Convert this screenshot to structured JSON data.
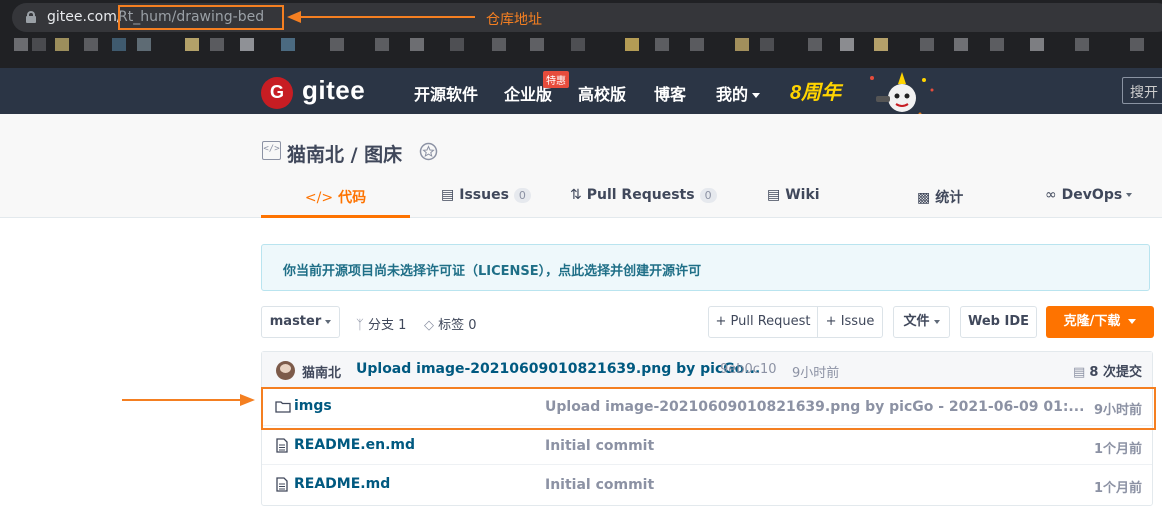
{
  "browser": {
    "url_host": "gitee.com/",
    "url_path": "Rt_hum/drawing-bed"
  },
  "annotation": {
    "url_label": "仓库地址",
    "color": "#f47f21"
  },
  "header": {
    "logo_text": "gitee",
    "nav": [
      "开源软件",
      "企业版",
      "高校版",
      "博客",
      "我的"
    ],
    "enterprise_badge": "特惠",
    "anniversary": "8周年",
    "search_placeholder": "搜开"
  },
  "repo": {
    "title": "猫南北 / 图床",
    "tabs": [
      {
        "label": "代码",
        "icon": "code-icon"
      },
      {
        "label": "Issues",
        "count": "0",
        "icon": "issues-icon"
      },
      {
        "label": "Pull Requests",
        "count": "0",
        "icon": "pull-request-icon"
      },
      {
        "label": "Wiki",
        "icon": "wiki-icon"
      },
      {
        "label": "统计",
        "icon": "stats-icon"
      },
      {
        "label": "DevOps",
        "icon": "devops-icon"
      }
    ]
  },
  "notice": {
    "text": "你当前开源项目尚未选择许可证（LICENSE），点此选择并创建开源许可"
  },
  "toolbar": {
    "branch": "master",
    "branches": "分支 1",
    "tags": "标签 0",
    "pull_request": "+ Pull Request",
    "issue": "+ Issue",
    "file": "文件",
    "web_ide": "Web IDE",
    "clone": "克隆/下载"
  },
  "last_commit": {
    "author": "猫南北",
    "message": "Upload image-20210609010821639.png by picGo...",
    "hash": "9eb0c10",
    "time": "9小时前",
    "commit_count": "8 次提交"
  },
  "files": [
    {
      "name": "imgs",
      "type": "folder",
      "message": "Upload image-20210609010821639.png by picGo - 2021-06-09 01:...",
      "time": "9小时前"
    },
    {
      "name": "README.en.md",
      "type": "file",
      "message": "Initial commit",
      "time": "1个月前"
    },
    {
      "name": "README.md",
      "type": "file",
      "message": "Initial commit",
      "time": "1个月前"
    }
  ],
  "colors": {
    "accent": "#fe7300",
    "header_bg": "#2b3545",
    "link": "#005980"
  }
}
